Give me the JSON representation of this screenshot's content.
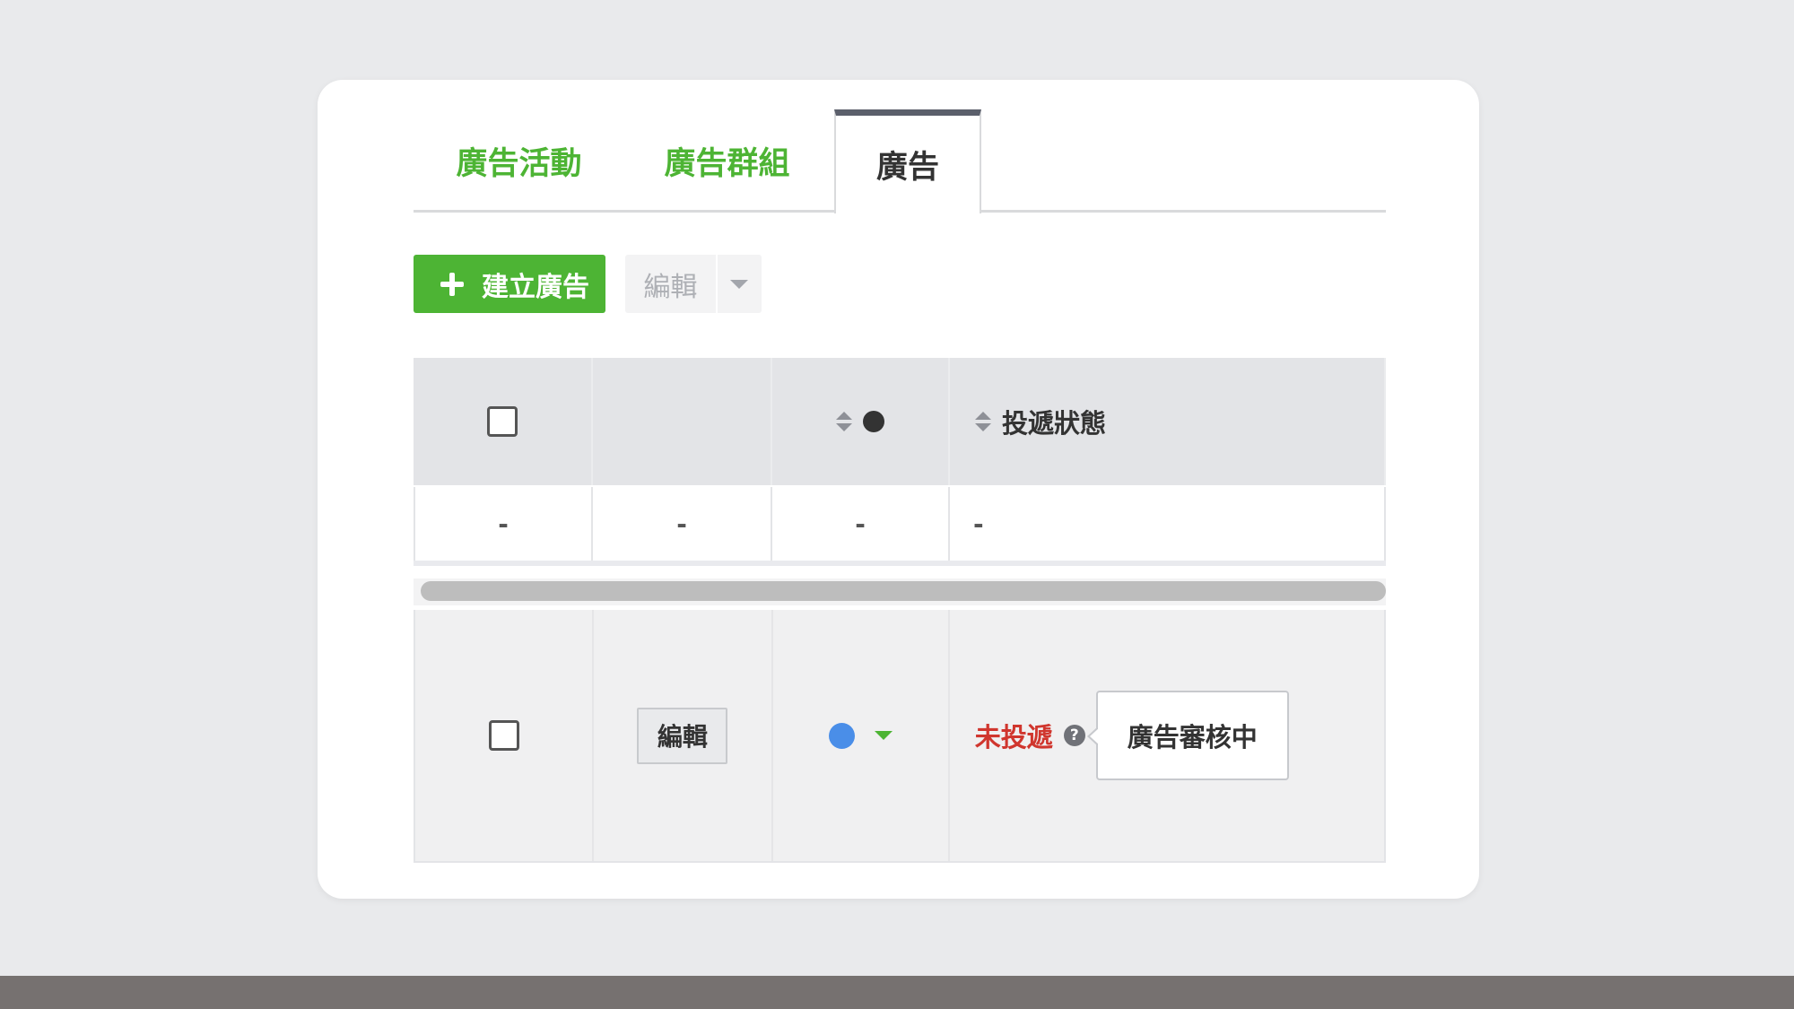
{
  "tabs": [
    {
      "label": "廣告活動",
      "active": false
    },
    {
      "label": "廣告群組",
      "active": false
    },
    {
      "label": "廣告",
      "active": true
    }
  ],
  "toolbar": {
    "create_label": "建立廣告",
    "edit_label": "編輯"
  },
  "table": {
    "header": {
      "status_label": "投遞狀態"
    },
    "summary_row": [
      "-",
      "-",
      "-",
      "-"
    ],
    "rows": [
      {
        "edit_label": "編輯",
        "status": "未投遞",
        "help_symbol": "?",
        "tooltip": "廣告審核中"
      }
    ]
  },
  "colors": {
    "brand_green": "#4db434",
    "status_red": "#d0362e",
    "dot_blue": "#4a8ee8"
  }
}
